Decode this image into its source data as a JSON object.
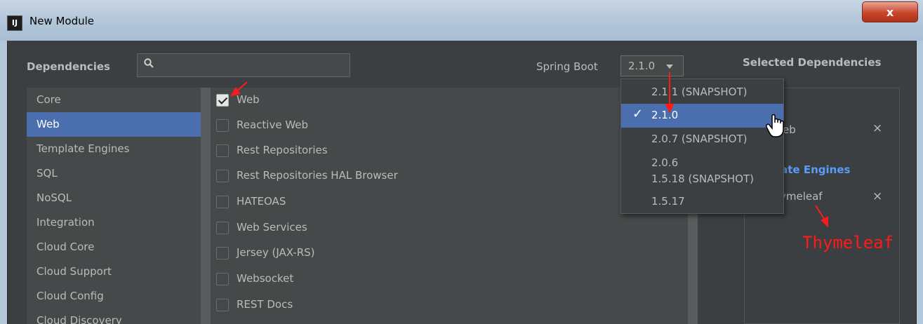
{
  "window": {
    "title": "New Module",
    "app_icon": "IJ",
    "close_label": "x"
  },
  "header": {
    "dependencies_label": "Dependencies",
    "search_value": "",
    "spring_boot_label": "Spring Boot",
    "spring_boot_version": "2.1.0",
    "selected_title": "Selected Dependencies"
  },
  "categories": [
    "Core",
    "Web",
    "Template Engines",
    "SQL",
    "NoSQL",
    "Integration",
    "Cloud Core",
    "Cloud Support",
    "Cloud Config",
    "Cloud Discovery"
  ],
  "active_category": "Web",
  "dependencies": [
    {
      "label": "Web",
      "checked": true
    },
    {
      "label": "Reactive Web",
      "checked": false
    },
    {
      "label": "Rest Repositories",
      "checked": false
    },
    {
      "label": "Rest Repositories HAL Browser",
      "checked": false
    },
    {
      "label": "HATEOAS",
      "checked": false
    },
    {
      "label": "Web Services",
      "checked": false
    },
    {
      "label": "Jersey (JAX-RS)",
      "checked": false
    },
    {
      "label": "Websocket",
      "checked": false
    },
    {
      "label": "REST Docs",
      "checked": false
    }
  ],
  "version_options": [
    "2.1.1 (SNAPSHOT)",
    "2.1.0",
    "2.0.7 (SNAPSHOT)",
    "2.0.6",
    "1.5.18 (SNAPSHOT)",
    "1.5.17"
  ],
  "selected_version_index": 1,
  "selected": {
    "web_text": "eb",
    "group_text": "late Engines",
    "thyme_text": "ymeleaf",
    "remove_label": "×"
  },
  "annotation": "Thymeleaf",
  "colors": {
    "accent": "#4b6eaf",
    "annotation": "#ff1a1a",
    "group": "#589df6"
  }
}
